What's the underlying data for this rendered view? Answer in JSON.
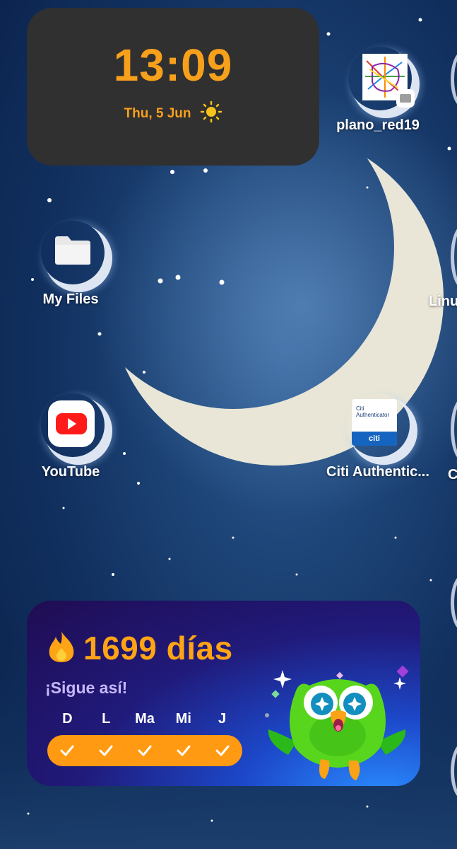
{
  "clock": {
    "time": "13:09",
    "date": "Thu, 5 Jun",
    "weather_icon": "sun-icon"
  },
  "apps": [
    {
      "label": "plano_red19",
      "icon": "map-icon"
    },
    {
      "label": "My Files",
      "icon": "folder-icon"
    },
    {
      "label": "Linux",
      "icon": "app-icon"
    },
    {
      "label": "YouTube",
      "icon": "youtube-icon"
    },
    {
      "label": "Citi Authentic...",
      "icon": "citi-icon"
    },
    {
      "label": "C",
      "icon": "app-icon"
    }
  ],
  "citi_icon": {
    "line1": "Citi",
    "line2": "Authenticator",
    "logo": "citi"
  },
  "duolingo": {
    "streak": "1699 días",
    "motto": "¡Sigue así!",
    "days": [
      "D",
      "L",
      "Ma",
      "Mi",
      "J"
    ],
    "accent": "#ff9a12"
  }
}
